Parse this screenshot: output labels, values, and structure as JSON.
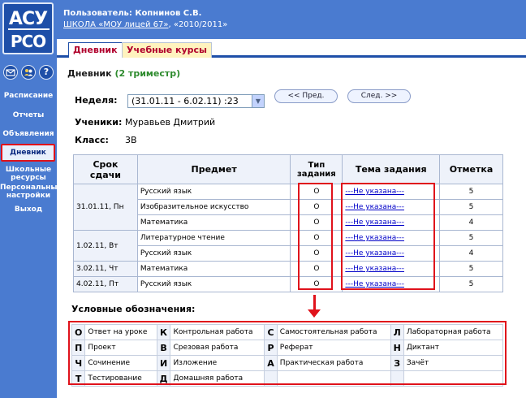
{
  "logo": {
    "line1": "АСУ",
    "line2": "РСО"
  },
  "header": {
    "user": "Пользователь: Копнинов С.В.",
    "school_link": "ШКОЛА «МОУ лицей 67»",
    "school_rest": ", «2010/2011»"
  },
  "tabs": [
    {
      "label": "Дневник"
    },
    {
      "label": "Учебные курсы"
    }
  ],
  "sidebar": {
    "icons": [
      "envelope-icon",
      "people-icon",
      "help-icon"
    ],
    "help_glyph": "?",
    "items": [
      {
        "label": "Расписание"
      },
      {
        "label": "Отчеты"
      },
      {
        "label": "Объявления"
      },
      {
        "label": "Дневник"
      },
      {
        "label_1": "Школьные",
        "label_2": "ресурсы"
      },
      {
        "label_1": "Персональные",
        "label_2": "настройки"
      },
      {
        "label": "Выход"
      }
    ]
  },
  "page": {
    "title": "Дневник",
    "term": "(2 триместр)",
    "week_label": "Неделя:",
    "week_value": "(31.01.11 - 6.02.11) :23",
    "prev_button": "<< Пред.",
    "next_button": "След. >>",
    "students_label": "Ученики:",
    "students_value": "Муравьев Дмитрий",
    "class_label": "Класс:",
    "class_value": "3В"
  },
  "table": {
    "headers": {
      "date_1": "Срок",
      "date_2": "сдачи",
      "subject": "Предмет",
      "type_1": "Тип",
      "type_2": "задания",
      "topic": "Тема задания",
      "mark": "Отметка"
    },
    "rows": [
      {
        "date": "31.01.11, Пн",
        "subject": "Русский язык",
        "type": "О",
        "topic": "---Не указана---",
        "mark": "5"
      },
      {
        "date": "",
        "subject": "Изобразительное искусство",
        "type": "О",
        "topic": "---Не указана---",
        "mark": "5"
      },
      {
        "date": "",
        "subject": "Математика",
        "type": "О",
        "topic": "---Не указана---",
        "mark": "4"
      },
      {
        "date": "1.02.11, Вт",
        "subject": "Литературное чтение",
        "type": "О",
        "topic": "---Не указана---",
        "mark": "5"
      },
      {
        "date": "",
        "subject": "Русский язык",
        "type": "О",
        "topic": "---Не указана---",
        "mark": "4"
      },
      {
        "date": "3.02.11, Чт",
        "subject": "Математика",
        "type": "О",
        "topic": "---Не указана---",
        "mark": "5"
      },
      {
        "date": "4.02.11, Пт",
        "subject": "Русский язык",
        "type": "О",
        "topic": "---Не указана---",
        "mark": "5"
      }
    ]
  },
  "legend": {
    "title": "Условные обозначения:",
    "rows": [
      [
        {
          "k": "О",
          "v": "Ответ на уроке"
        },
        {
          "k": "К",
          "v": "Контрольная работа"
        },
        {
          "k": "С",
          "v": "Самостоятельная работа"
        },
        {
          "k": "Л",
          "v": "Лабораторная работа"
        }
      ],
      [
        {
          "k": "П",
          "v": "Проект"
        },
        {
          "k": "В",
          "v": "Срезовая работа"
        },
        {
          "k": "Р",
          "v": "Реферат"
        },
        {
          "k": "Н",
          "v": "Диктант"
        }
      ],
      [
        {
          "k": "Ч",
          "v": "Сочинение"
        },
        {
          "k": "И",
          "v": "Изложение"
        },
        {
          "k": "А",
          "v": "Практическая работа"
        },
        {
          "k": "З",
          "v": "Зачёт"
        }
      ],
      [
        {
          "k": "Т",
          "v": "Тестирование"
        },
        {
          "k": "Д",
          "v": "Домашняя работа"
        },
        {
          "k": "",
          "v": ""
        },
        {
          "k": "",
          "v": ""
        }
      ]
    ]
  },
  "colors": {
    "accent": "#4a7bd0",
    "highlight": "#e0121b",
    "term": "#2e8b2e",
    "tab_text": "#b0002c"
  }
}
